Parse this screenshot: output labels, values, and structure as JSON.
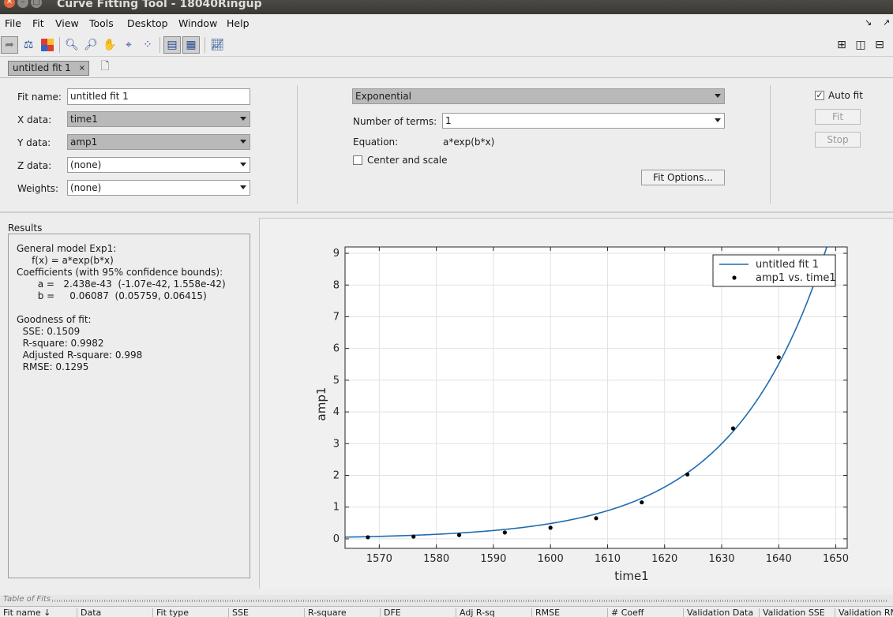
{
  "window": {
    "title": "Curve Fitting Tool - 18040Ringup"
  },
  "menu": [
    {
      "key": "F",
      "rest": "ile"
    },
    {
      "key": "",
      "pre": "F",
      "keyc": "i",
      "rest": "t"
    },
    {
      "key": "V",
      "rest": "iew"
    },
    {
      "key": "T",
      "rest": "ools"
    },
    {
      "key": "D",
      "rest": "esktop"
    },
    {
      "key": "W",
      "rest": "indow"
    },
    {
      "key": "H",
      "rest": "elp"
    }
  ],
  "menu_labels": [
    "File",
    "Fit",
    "View",
    "Tools",
    "Desktop",
    "Window",
    "Help"
  ],
  "tab": {
    "label": "untitled fit 1",
    "close": "×"
  },
  "fit": {
    "fit_name_label": "Fit name:",
    "fit_name_value": "untitled fit 1",
    "x_data_label": "X data:",
    "x_data_value": "time1",
    "y_data_label": "Y data:",
    "y_data_value": "amp1",
    "z_data_label": "Z data:",
    "z_data_value": "(none)",
    "weights_label": "Weights:",
    "weights_value": "(none)",
    "fit_type": "Exponential",
    "num_terms_label": "Number of terms:",
    "num_terms_value": "1",
    "equation_label": "Equation:",
    "equation_value": "a*exp(b*x)",
    "center_scale_label": "Center and scale",
    "center_scale_checked": false,
    "fit_options_label": "Fit Options...",
    "auto_fit_label": "Auto fit",
    "auto_fit_checked": true,
    "fit_button_label": "Fit",
    "stop_button_label": "Stop"
  },
  "results": {
    "label": "Results",
    "lines": [
      "General model Exp1:",
      "     f(x) = a*exp(b*x)",
      "Coefficients (with 95% confidence bounds):",
      "       a =   2.438e-43  (-1.07e-42, 1.558e-42)",
      "       b =     0.06087  (0.05759, 0.06415)",
      "",
      "Goodness of fit:",
      "  SSE: 0.1509",
      "  R-square: 0.9982",
      "  Adjusted R-square: 0.998",
      "  RMSE: 0.1295"
    ]
  },
  "chart_data": {
    "type": "scatter",
    "xlabel": "time1",
    "ylabel": "amp1",
    "xlim": [
      1564,
      1652
    ],
    "ylim": [
      -0.3,
      9.2
    ],
    "xticks": [
      1570,
      1580,
      1590,
      1600,
      1610,
      1620,
      1630,
      1640,
      1650
    ],
    "yticks": [
      0,
      1,
      2,
      3,
      4,
      5,
      6,
      7,
      8,
      9
    ],
    "grid": true,
    "legend_position": "top-right",
    "series": [
      {
        "name": "untitled fit 1",
        "kind": "line",
        "color": "#1f6cb0",
        "model": {
          "a": 2.438e-43,
          "b": 0.06087
        }
      },
      {
        "name": "amp1 vs. time1",
        "kind": "points",
        "color": "#000000",
        "x": [
          1568,
          1576,
          1584,
          1592,
          1600,
          1608,
          1616,
          1624,
          1632,
          1640
        ],
        "y": [
          0.05,
          0.07,
          0.12,
          0.2,
          0.35,
          0.65,
          1.15,
          2.03,
          3.48,
          5.72
        ]
      }
    ]
  },
  "table": {
    "title": "Table of Fits",
    "columns": [
      "Fit name ↓",
      "Data",
      "Fit type",
      "SSE",
      "R-square",
      "DFE",
      "Adj R-sq",
      "RMSE",
      "# Coeff",
      "Validation Data",
      "Validation SSE",
      "Validation RM"
    ]
  },
  "icons": [
    "back-icon",
    "data-icon",
    "colormap-icon",
    "zoom-in-icon",
    "zoom-out-icon",
    "pan-icon",
    "data-cursor-icon",
    "exclude-icon",
    "grid-layout-icon",
    "table-layout-icon",
    "residuals-icon",
    "tile-icon",
    "split-vertical-icon",
    "split-horizontal-icon",
    "new-fit-icon"
  ]
}
